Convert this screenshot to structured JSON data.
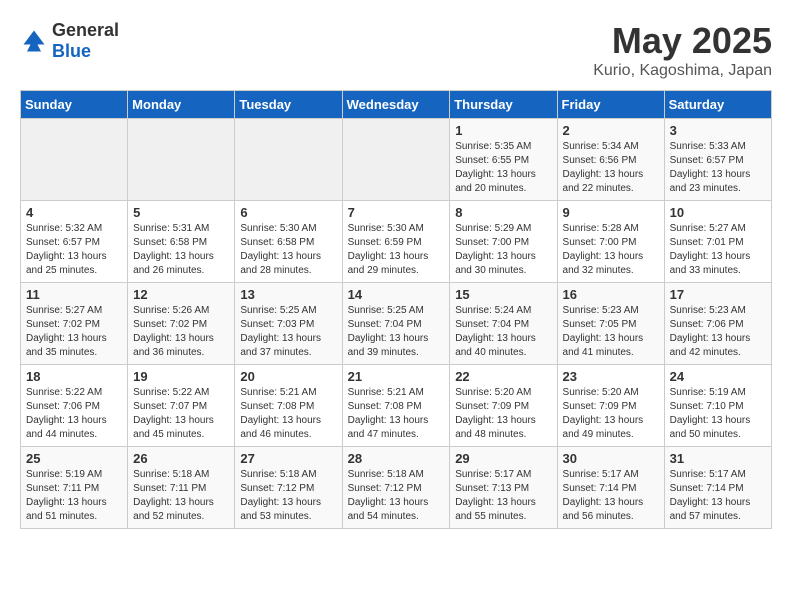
{
  "header": {
    "logo_general": "General",
    "logo_blue": "Blue",
    "month": "May 2025",
    "location": "Kurio, Kagoshima, Japan"
  },
  "weekdays": [
    "Sunday",
    "Monday",
    "Tuesday",
    "Wednesday",
    "Thursday",
    "Friday",
    "Saturday"
  ],
  "weeks": [
    [
      {
        "day": "",
        "info": ""
      },
      {
        "day": "",
        "info": ""
      },
      {
        "day": "",
        "info": ""
      },
      {
        "day": "",
        "info": ""
      },
      {
        "day": "1",
        "info": "Sunrise: 5:35 AM\nSunset: 6:55 PM\nDaylight: 13 hours\nand 20 minutes."
      },
      {
        "day": "2",
        "info": "Sunrise: 5:34 AM\nSunset: 6:56 PM\nDaylight: 13 hours\nand 22 minutes."
      },
      {
        "day": "3",
        "info": "Sunrise: 5:33 AM\nSunset: 6:57 PM\nDaylight: 13 hours\nand 23 minutes."
      }
    ],
    [
      {
        "day": "4",
        "info": "Sunrise: 5:32 AM\nSunset: 6:57 PM\nDaylight: 13 hours\nand 25 minutes."
      },
      {
        "day": "5",
        "info": "Sunrise: 5:31 AM\nSunset: 6:58 PM\nDaylight: 13 hours\nand 26 minutes."
      },
      {
        "day": "6",
        "info": "Sunrise: 5:30 AM\nSunset: 6:58 PM\nDaylight: 13 hours\nand 28 minutes."
      },
      {
        "day": "7",
        "info": "Sunrise: 5:30 AM\nSunset: 6:59 PM\nDaylight: 13 hours\nand 29 minutes."
      },
      {
        "day": "8",
        "info": "Sunrise: 5:29 AM\nSunset: 7:00 PM\nDaylight: 13 hours\nand 30 minutes."
      },
      {
        "day": "9",
        "info": "Sunrise: 5:28 AM\nSunset: 7:00 PM\nDaylight: 13 hours\nand 32 minutes."
      },
      {
        "day": "10",
        "info": "Sunrise: 5:27 AM\nSunset: 7:01 PM\nDaylight: 13 hours\nand 33 minutes."
      }
    ],
    [
      {
        "day": "11",
        "info": "Sunrise: 5:27 AM\nSunset: 7:02 PM\nDaylight: 13 hours\nand 35 minutes."
      },
      {
        "day": "12",
        "info": "Sunrise: 5:26 AM\nSunset: 7:02 PM\nDaylight: 13 hours\nand 36 minutes."
      },
      {
        "day": "13",
        "info": "Sunrise: 5:25 AM\nSunset: 7:03 PM\nDaylight: 13 hours\nand 37 minutes."
      },
      {
        "day": "14",
        "info": "Sunrise: 5:25 AM\nSunset: 7:04 PM\nDaylight: 13 hours\nand 39 minutes."
      },
      {
        "day": "15",
        "info": "Sunrise: 5:24 AM\nSunset: 7:04 PM\nDaylight: 13 hours\nand 40 minutes."
      },
      {
        "day": "16",
        "info": "Sunrise: 5:23 AM\nSunset: 7:05 PM\nDaylight: 13 hours\nand 41 minutes."
      },
      {
        "day": "17",
        "info": "Sunrise: 5:23 AM\nSunset: 7:06 PM\nDaylight: 13 hours\nand 42 minutes."
      }
    ],
    [
      {
        "day": "18",
        "info": "Sunrise: 5:22 AM\nSunset: 7:06 PM\nDaylight: 13 hours\nand 44 minutes."
      },
      {
        "day": "19",
        "info": "Sunrise: 5:22 AM\nSunset: 7:07 PM\nDaylight: 13 hours\nand 45 minutes."
      },
      {
        "day": "20",
        "info": "Sunrise: 5:21 AM\nSunset: 7:08 PM\nDaylight: 13 hours\nand 46 minutes."
      },
      {
        "day": "21",
        "info": "Sunrise: 5:21 AM\nSunset: 7:08 PM\nDaylight: 13 hours\nand 47 minutes."
      },
      {
        "day": "22",
        "info": "Sunrise: 5:20 AM\nSunset: 7:09 PM\nDaylight: 13 hours\nand 48 minutes."
      },
      {
        "day": "23",
        "info": "Sunrise: 5:20 AM\nSunset: 7:09 PM\nDaylight: 13 hours\nand 49 minutes."
      },
      {
        "day": "24",
        "info": "Sunrise: 5:19 AM\nSunset: 7:10 PM\nDaylight: 13 hours\nand 50 minutes."
      }
    ],
    [
      {
        "day": "25",
        "info": "Sunrise: 5:19 AM\nSunset: 7:11 PM\nDaylight: 13 hours\nand 51 minutes."
      },
      {
        "day": "26",
        "info": "Sunrise: 5:18 AM\nSunset: 7:11 PM\nDaylight: 13 hours\nand 52 minutes."
      },
      {
        "day": "27",
        "info": "Sunrise: 5:18 AM\nSunset: 7:12 PM\nDaylight: 13 hours\nand 53 minutes."
      },
      {
        "day": "28",
        "info": "Sunrise: 5:18 AM\nSunset: 7:12 PM\nDaylight: 13 hours\nand 54 minutes."
      },
      {
        "day": "29",
        "info": "Sunrise: 5:17 AM\nSunset: 7:13 PM\nDaylight: 13 hours\nand 55 minutes."
      },
      {
        "day": "30",
        "info": "Sunrise: 5:17 AM\nSunset: 7:14 PM\nDaylight: 13 hours\nand 56 minutes."
      },
      {
        "day": "31",
        "info": "Sunrise: 5:17 AM\nSunset: 7:14 PM\nDaylight: 13 hours\nand 57 minutes."
      }
    ]
  ]
}
